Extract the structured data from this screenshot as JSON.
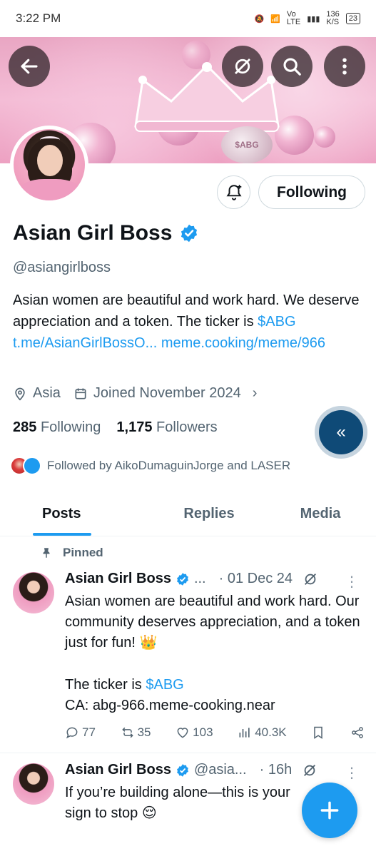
{
  "status_bar": {
    "time": "3:22 PM",
    "net_speed": "136",
    "net_unit": "K/S",
    "vo_label": "Vo",
    "lte_label": "LTE",
    "battery": "23"
  },
  "profile": {
    "name": "Asian Girl Boss",
    "handle": "@asiangirlboss",
    "bio_text": "Asian women are beautiful and work hard. We deserve appreciation and a token. The ticker is",
    "bio_ticker": "$ABG",
    "bio_link1": "t.me/AsianGirlBossO...",
    "bio_link2": "meme.cooking/meme/966",
    "location": "Asia",
    "joined": "Joined November 2024",
    "following_count": "285",
    "following_label": "Following",
    "followers_count": "1,175",
    "followers_label": "Followers",
    "followed_by": "Followed by AikoDumaguinJorge and LASER",
    "follow_button": "Following",
    "banner_coin": "$ABG"
  },
  "tabs": [
    "Posts",
    "Replies",
    "Media"
  ],
  "pinned_label": "Pinned",
  "posts": [
    {
      "name": "Asian Girl Boss",
      "handle": "...",
      "time": "· 01 Dec 24",
      "text_line1": "Asian women are beautiful and work hard.  Our community deserves appreciation, and a token just for fun! 👑",
      "text_ticker_prefix": "The ticker is ",
      "text_ticker": "$ABG",
      "text_ca": "CA: abg-966.meme-cooking.near",
      "replies": "77",
      "reposts": "35",
      "likes": "103",
      "views": "40.3K"
    },
    {
      "name": "Asian Girl Boss",
      "handle": "@asia...",
      "time": "· 16h",
      "text_line1": "If you’re building alone—this is your sign to stop 😌"
    }
  ],
  "colors": {
    "accent": "#1d9bf0",
    "text": "#0f1419",
    "muted": "#536471",
    "collapse_fab": "#0f4a77"
  }
}
